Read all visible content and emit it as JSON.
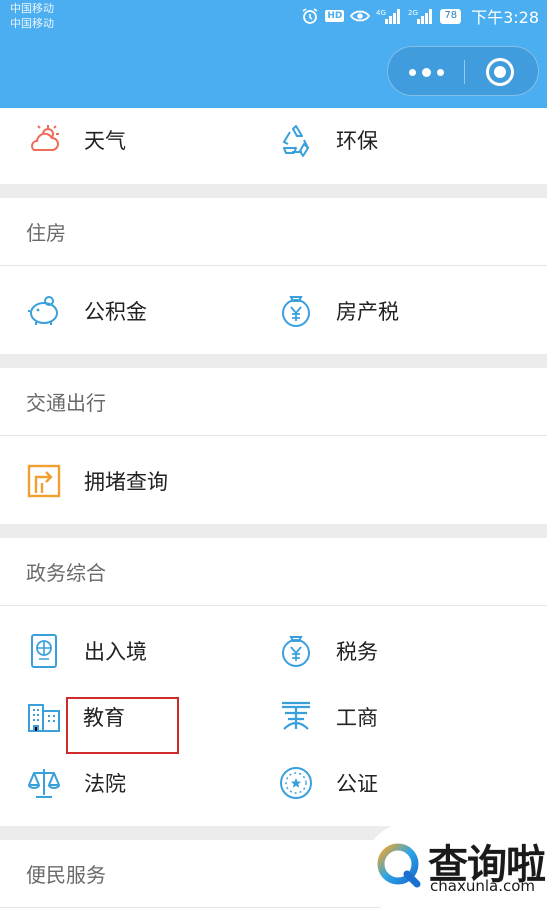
{
  "status_bar": {
    "carrier_1": "中国移动",
    "carrier_2": "中国移动",
    "network_1": "4G",
    "network_2": "2G",
    "battery": "78",
    "time": "下午3:28",
    "hd_label": "HD"
  },
  "capsule": {
    "more_icon": "more-dots-icon",
    "close_icon": "target-close-icon"
  },
  "top_row": {
    "items": [
      {
        "label": "天气",
        "icon": "weather-icon"
      },
      {
        "label": "环保",
        "icon": "recycle-icon"
      }
    ]
  },
  "sections": {
    "housing": {
      "title": "住房",
      "items": [
        {
          "label": "公积金",
          "icon": "piggy-bank-icon"
        },
        {
          "label": "房产税",
          "icon": "tax-bag-icon"
        }
      ]
    },
    "traffic": {
      "title": "交通出行",
      "items": [
        {
          "label": "拥堵查询",
          "icon": "traffic-sign-icon"
        }
      ]
    },
    "gov": {
      "title": "政务综合",
      "items": [
        {
          "label": "出入境",
          "icon": "passport-icon"
        },
        {
          "label": "税务",
          "icon": "tax-bag-icon"
        },
        {
          "label": "教育",
          "icon": "school-building-icon"
        },
        {
          "label": "工商",
          "icon": "business-icon"
        },
        {
          "label": "法院",
          "icon": "scales-icon"
        },
        {
          "label": "公证",
          "icon": "seal-icon"
        }
      ]
    },
    "service": {
      "title": "便民服务"
    }
  },
  "watermark": {
    "title": "查询啦",
    "subtitle": "chaxunla.com"
  },
  "colors": {
    "topbar": "#4aaef0",
    "icon_blue": "#3aa0dc",
    "icon_orange": "#f0a030",
    "icon_red": "#ef6b5a",
    "highlight": "#d02b2b"
  }
}
